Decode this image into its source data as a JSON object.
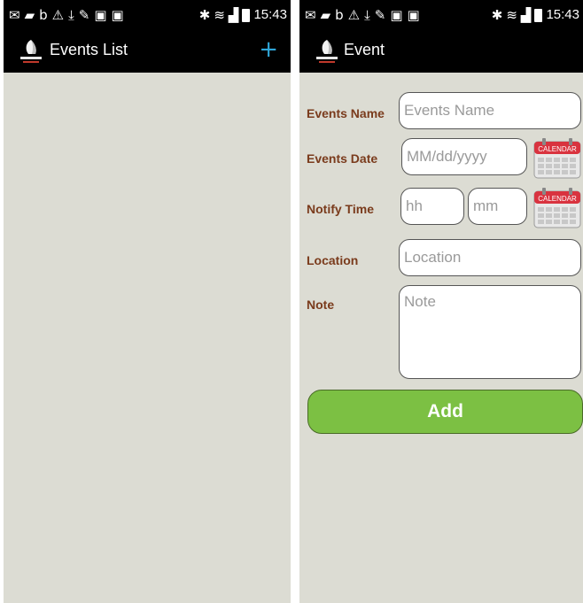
{
  "status_bar": {
    "time": "15:43"
  },
  "events_list_screen": {
    "title": "Events List",
    "add_icon": "plus-icon",
    "add_icon_color": "#2fa6d8"
  },
  "event_screen": {
    "title": "Event",
    "fields": {
      "events_name": {
        "label": "Events Name",
        "placeholder": "Events Name"
      },
      "events_date": {
        "label": "Events Date",
        "placeholder": "MM/dd/yyyy"
      },
      "notify_time": {
        "label": "Notify Time",
        "hour_placeholder": "hh",
        "minute_placeholder": "mm"
      },
      "location": {
        "label": "Location",
        "placeholder": "Location"
      },
      "note": {
        "label": "Note",
        "placeholder": "Note"
      }
    },
    "calendar_label": "CALENDAR",
    "add_button": "Add"
  },
  "colors": {
    "background": "#dcdcd3",
    "action_bar": "#000000",
    "label": "#7a3b1c",
    "add_button": "#7cc043"
  }
}
